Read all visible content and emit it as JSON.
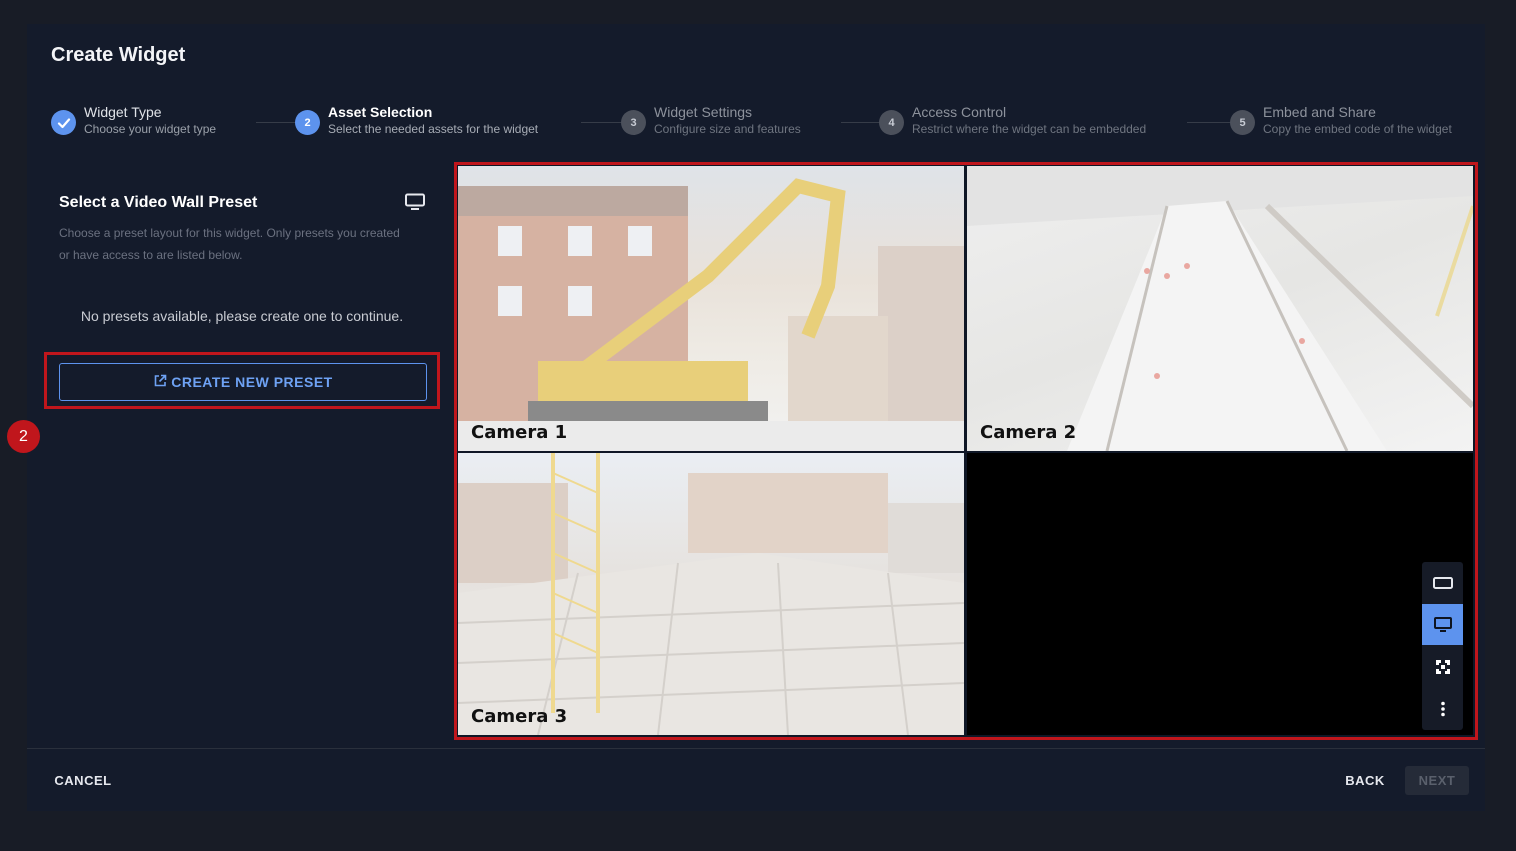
{
  "dialog": {
    "title": "Create Widget"
  },
  "steps": [
    {
      "number": "",
      "title": "Widget Type",
      "subtitle": "Choose your widget type",
      "state": "done"
    },
    {
      "number": "2",
      "title": "Asset Selection",
      "subtitle": "Select the needed assets for the widget",
      "state": "active"
    },
    {
      "number": "3",
      "title": "Widget Settings",
      "subtitle": "Configure size and features",
      "state": "pending"
    },
    {
      "number": "4",
      "title": "Access Control",
      "subtitle": "Restrict where the widget can be embedded",
      "state": "pending"
    },
    {
      "number": "5",
      "title": "Embed and Share",
      "subtitle": "Copy the embed code of the widget",
      "state": "pending"
    }
  ],
  "panel": {
    "title": "Select a Video Wall Preset",
    "title_icon": "monitor-icon",
    "description": "Choose a preset layout for this widget. Only presets you created or have access to are listed below.",
    "empty_message": "No presets available, please create one to continue.",
    "create_button": "CREATE NEW PRESET",
    "create_button_icon": "open-external-icon"
  },
  "annotation": {
    "badge": "2"
  },
  "video_wall": {
    "tiles": [
      {
        "label": "Camera 1"
      },
      {
        "label": "Camera 2"
      },
      {
        "label": "Camera 3"
      },
      {
        "label": ""
      }
    ],
    "toolbar": [
      {
        "icon": "aspect-ratio-icon",
        "active": false
      },
      {
        "icon": "monitor-icon",
        "active": true
      },
      {
        "icon": "fullscreen-icon",
        "active": false
      },
      {
        "icon": "more-vertical-icon",
        "active": false
      }
    ]
  },
  "footer": {
    "cancel": "CANCEL",
    "back": "BACK",
    "next": "NEXT"
  },
  "colors": {
    "accent": "#5d93ee",
    "annotation_red": "#c0161c",
    "background": "#141b2b"
  }
}
